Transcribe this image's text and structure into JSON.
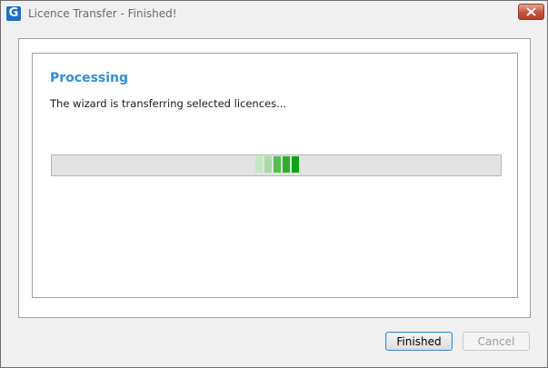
{
  "window": {
    "title": "Licence Transfer - Finished!",
    "app_icon_letter": "G"
  },
  "content": {
    "heading": "Processing",
    "description": "The wizard is transferring selected licences...",
    "progress": {
      "style": "marquee",
      "chunk_colors": [
        "#c4e6c0",
        "#a8dba3",
        "#57bd4f",
        "#2fae2a",
        "#0fa312"
      ]
    }
  },
  "buttons": {
    "finished": "Finished",
    "cancel": "Cancel"
  },
  "colors": {
    "heading": "#2e8fe0",
    "close_button": "#c7523d",
    "progress_track": "#e3e3e3"
  }
}
